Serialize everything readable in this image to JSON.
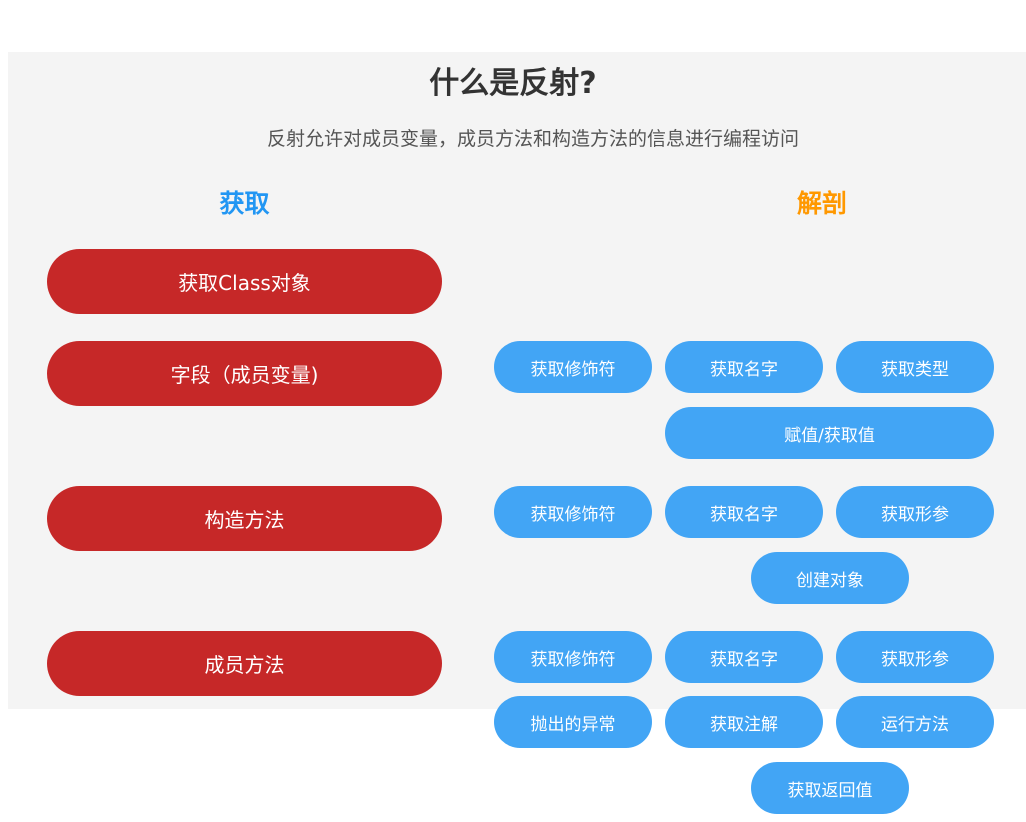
{
  "title": "什么是反射?",
  "subtitle": "反射允许对成员变量，成员方法和构造方法的信息进行编程访问",
  "colors": {
    "acquire": "#c62828",
    "dissect": "#42a5f5",
    "acquire_heading": "#2196f3",
    "dissect_heading": "#ff9800"
  },
  "headings": {
    "acquire": "获取",
    "dissect": "解剖"
  },
  "acquire": {
    "class_object": "获取Class对象",
    "field": "字段（成员变量)",
    "constructor": "构造方法",
    "method": "成员方法"
  },
  "field_ops": {
    "modifier": "获取修饰符",
    "name": "获取名字",
    "type": "获取类型",
    "set_get": "赋值/获取值"
  },
  "constructor_ops": {
    "modifier": "获取修饰符",
    "name": "获取名字",
    "params": "获取形参",
    "create": "创建对象"
  },
  "method_ops": {
    "modifier": "获取修饰符",
    "name": "获取名字",
    "params": "获取形参",
    "exceptions": "抛出的异常",
    "annotations": "获取注解",
    "invoke": "运行方法",
    "return_value": "获取返回值"
  }
}
